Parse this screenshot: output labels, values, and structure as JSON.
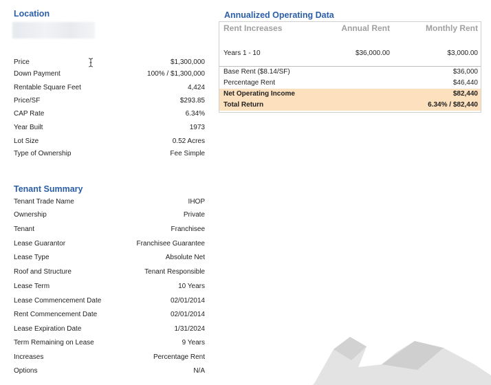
{
  "location": {
    "title": "Location",
    "rows": [
      {
        "label": "Price",
        "value": "$1,300,000"
      },
      {
        "label": "Down Payment",
        "value": "100% / $1,300,000"
      },
      {
        "label": "Rentable Square Feet",
        "value": "4,424"
      },
      {
        "label": "Price/SF",
        "value": "$293.85"
      },
      {
        "label": "CAP Rate",
        "value": "6.34%"
      },
      {
        "label": "Year Built",
        "value": "1973"
      },
      {
        "label": "Lot Size",
        "value": "0.52 Acres"
      },
      {
        "label": "Type of Ownership",
        "value": "Fee Simple"
      }
    ]
  },
  "tenant": {
    "title": "Tenant Summary",
    "rows": [
      {
        "label": "Tenant Trade Name",
        "value": "IHOP"
      },
      {
        "label": "Ownership",
        "value": "Private"
      },
      {
        "label": "Tenant",
        "value": "Franchisee"
      },
      {
        "label": "Lease Guarantor",
        "value": "Franchisee Guarantee"
      },
      {
        "label": "Lease Type",
        "value": "Absolute Net"
      },
      {
        "label": "Roof and Structure",
        "value": "Tenant Responsible"
      },
      {
        "label": "Lease Term",
        "value": "10 Years"
      },
      {
        "label": "Lease Commencement Date",
        "value": "02/01/2014"
      },
      {
        "label": "Rent Commencement Date",
        "value": "02/01/2014"
      },
      {
        "label": "Lease Expiration Date",
        "value": "1/31/2024"
      },
      {
        "label": "Term Remaining on Lease",
        "value": "9 Years"
      },
      {
        "label": "Increases",
        "value": "Percentage Rent"
      },
      {
        "label": "Options",
        "value": "N/A"
      }
    ]
  },
  "operating": {
    "title": "Annualized Operating Data",
    "headers": {
      "col1": "Rent Increases",
      "col2": "Annual Rent",
      "col3": "Monthly Rent"
    },
    "years_row": {
      "label": "Years 1 - 10",
      "annual": "$36,000.00",
      "monthly": "$3,000.00"
    },
    "rows": [
      {
        "label": "Base Rent  ($8.14/SF)",
        "value": "$36,000"
      },
      {
        "label": "Percentage Rent",
        "value": "$46,440"
      },
      {
        "label": "Net Operating Income",
        "value": "$82,440"
      },
      {
        "label": "Total Return",
        "value": "6.34% / $82,440"
      }
    ],
    "highlight_color": "#fde0bd"
  },
  "colors": {
    "heading": "#2b5ea8",
    "muted_header": "#a0a0a0"
  }
}
